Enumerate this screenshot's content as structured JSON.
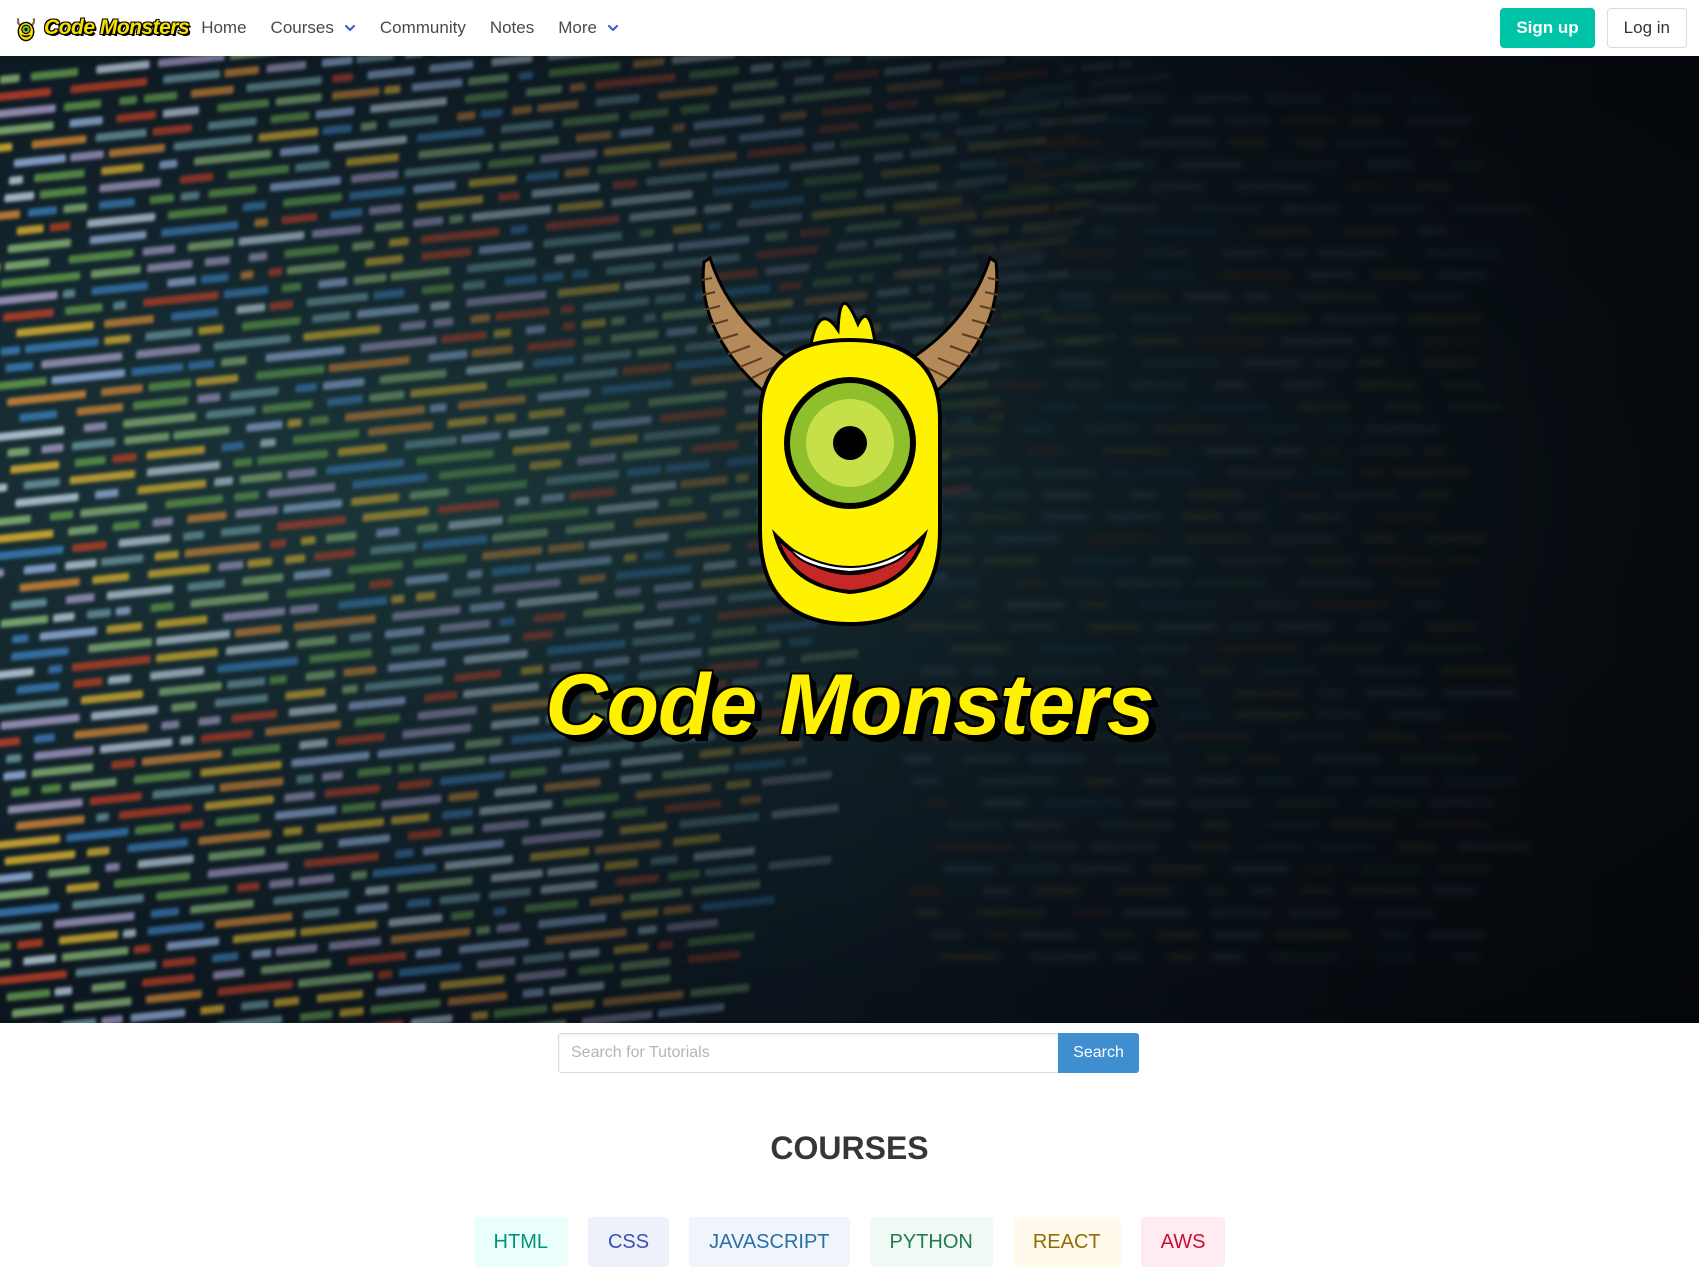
{
  "nav": {
    "brand": "Code Monsters",
    "items": [
      {
        "label": "Home",
        "dropdown": false
      },
      {
        "label": "Courses",
        "dropdown": true
      },
      {
        "label": "Community",
        "dropdown": false
      },
      {
        "label": "Notes",
        "dropdown": false
      },
      {
        "label": "More",
        "dropdown": true
      }
    ],
    "signup_label": "Sign up",
    "login_label": "Log in"
  },
  "hero": {
    "title": "Code Monsters"
  },
  "search": {
    "placeholder": "Search for Tutorials",
    "value": "",
    "button_label": "Search"
  },
  "courses": {
    "title": "COURSES",
    "tags": [
      {
        "label": "HTML",
        "bg": "#ebfffc",
        "color": "#00947e"
      },
      {
        "label": "CSS",
        "bg": "#eff1fa",
        "color": "#3850b7"
      },
      {
        "label": "JAVASCRIPT",
        "bg": "#eff5fb",
        "color": "#296fa8"
      },
      {
        "label": "PYTHON",
        "bg": "#effaf5",
        "color": "#257953"
      },
      {
        "label": "REACT",
        "bg": "#fffaeb",
        "color": "#946c00"
      },
      {
        "label": "AWS",
        "bg": "#feecf0",
        "color": "#cc0f35"
      }
    ]
  },
  "colors": {
    "accent_signup": "#00c4a7",
    "search_button": "#3e8ed0",
    "brand_yellow": "#fff100"
  }
}
